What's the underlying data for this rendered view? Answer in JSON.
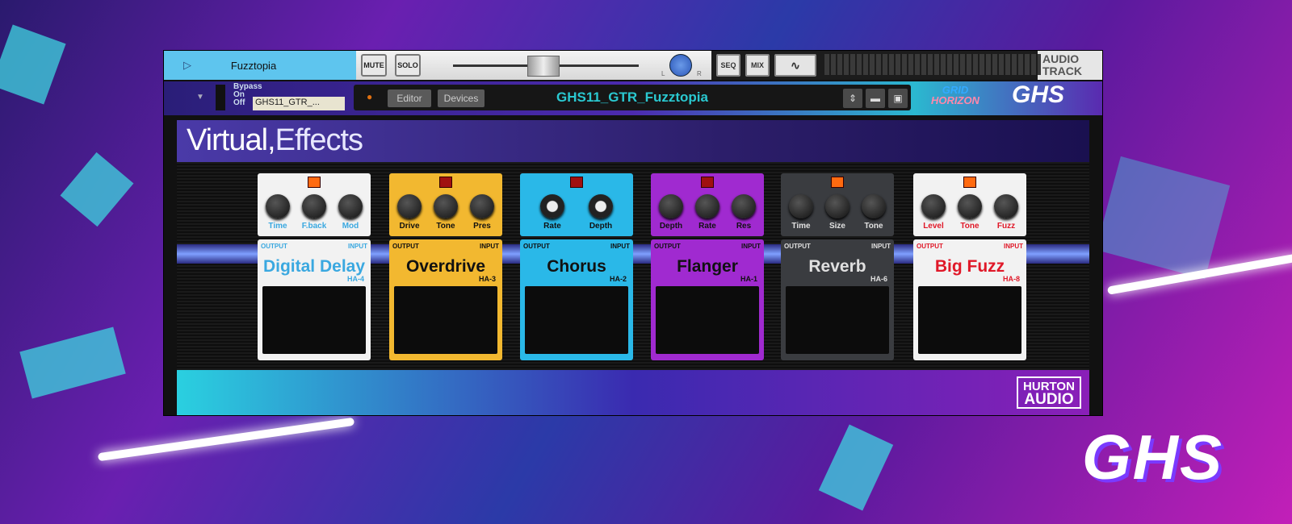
{
  "track": {
    "name": "Fuzztopia",
    "mute": "MUTE",
    "solo": "SOLO",
    "pan_l": "L",
    "pan_r": "R",
    "seq": "SEQ",
    "mix": "MIX",
    "type_line1": "AUDIO",
    "type_line2": "TRACK"
  },
  "device": {
    "bypass": "Bypass",
    "on": "On",
    "off": "Off",
    "short_name": "GHS11_GTR_...",
    "editor": "Editor",
    "devices": "Devices",
    "patch": "GHS11_GTR_Fuzztopia",
    "logo_grid": "GRID",
    "logo_horizon": "HORIZON",
    "logo_ghs": "GHS"
  },
  "heading": {
    "part1": "Virtual,",
    "part2": "Effects"
  },
  "pedals": [
    {
      "name": "Digital Delay",
      "model": "HA-4",
      "led_on": true,
      "knobs": [
        "Time",
        "F.back",
        "Mod"
      ],
      "color": "#f2f2f2",
      "text": "#3aa8e0"
    },
    {
      "name": "Overdrive",
      "model": "HA-3",
      "led_on": false,
      "knobs": [
        "Drive",
        "Tone",
        "Pres"
      ],
      "color": "#f2b830",
      "text": "#111111"
    },
    {
      "name": "Chorus",
      "model": "HA-2",
      "led_on": false,
      "knobs": [
        "Rate",
        "Depth"
      ],
      "color": "#2ab8e8",
      "text": "#111111"
    },
    {
      "name": "Flanger",
      "model": "HA-1",
      "led_on": false,
      "knobs": [
        "Depth",
        "Rate",
        "Res"
      ],
      "color": "#a02ad0",
      "text": "#111111"
    },
    {
      "name": "Reverb",
      "model": "HA-6",
      "led_on": true,
      "knobs": [
        "Time",
        "Size",
        "Tone"
      ],
      "color": "#3a3c40",
      "text": "#e0e0e0"
    },
    {
      "name": "Big Fuzz",
      "model": "HA-8",
      "led_on": true,
      "knobs": [
        "Level",
        "Tone",
        "Fuzz"
      ],
      "color": "#f2f2f2",
      "text": "#e01828"
    }
  ],
  "jack": {
    "output": "OUTPUT",
    "input": "INPUT"
  },
  "footer": {
    "brand1": "HURTON",
    "brand2": "AUDIO"
  },
  "watermark": "GHS"
}
